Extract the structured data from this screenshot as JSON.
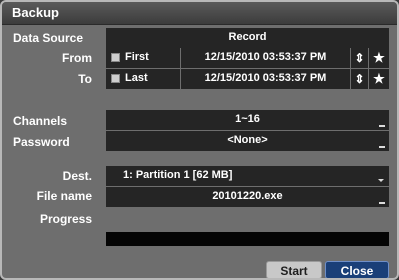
{
  "window": {
    "title": "Backup"
  },
  "data_source": {
    "label": "Data Source",
    "value": "Record"
  },
  "from": {
    "label": "From",
    "checkbox_label": "First",
    "datetime": "12/15/2010  03:53:37 PM",
    "spin_glyph": "⇕",
    "star_glyph": "★"
  },
  "to": {
    "label": "To",
    "checkbox_label": "Last",
    "datetime": "12/15/2010  03:53:37 PM",
    "spin_glyph": "⇕",
    "star_glyph": "★"
  },
  "channels": {
    "label": "Channels",
    "value": "1~16"
  },
  "password": {
    "label": "Password",
    "value": "<None>"
  },
  "dest": {
    "label": "Dest.",
    "value": "1: Partition 1 [62 MB]"
  },
  "file_name": {
    "label": "File name",
    "value": "20101220.exe"
  },
  "progress": {
    "label": "Progress",
    "percent": 0
  },
  "buttons": {
    "start": "Start",
    "close": "Close"
  },
  "colors": {
    "panel": "#6e6e6e",
    "field": "#252525",
    "start_button": "#c8c8c8",
    "close_button": "#1a3f78"
  }
}
